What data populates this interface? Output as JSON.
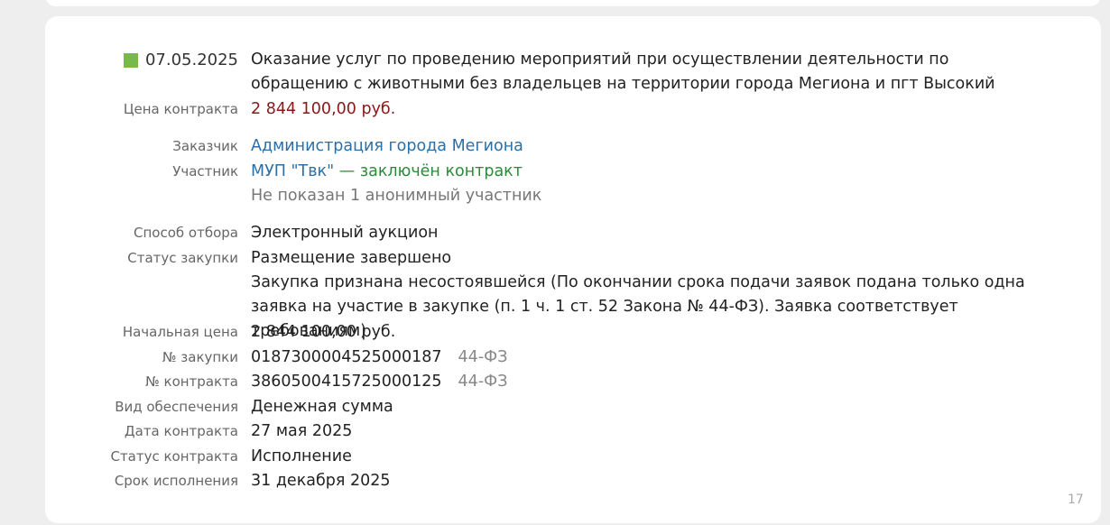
{
  "tender": {
    "date": "07.05.2025",
    "title": "Оказание услуг по проведению мероприятий при осуществлении деятельности по обращению с животными без владельцев на территории города Мегиона и пгт Высокий",
    "price_label": "Цена контракта",
    "price": "2 844 100,00 руб.",
    "customer_label": "Заказчик",
    "customer": "Администрация города Мегиона",
    "participant_label": "Участник",
    "participant": "МУП \"Твк\"",
    "participant_status": "— заключён контракт",
    "hidden_participants": "Не показан 1 анонимный участник",
    "method_label": "Способ отбора",
    "method": "Электронный аукцион",
    "status_label": "Статус закупки",
    "status": "Размещение завершено",
    "status_note": "Закупка признана несостоявшейся (По окончании срока подачи заявок подана только одна заявка на участие в закупке (п. 1 ч. 1 ст. 52 Закона № 44-ФЗ). Заявка соответствует требованиям)",
    "start_price_label": "Начальная цена",
    "start_price": "2 844 100,00 руб.",
    "purchase_no_label": "№ закупки",
    "purchase_no": "0187300004525000187",
    "purchase_law": "44-ФЗ",
    "contract_no_label": "№ контракта",
    "contract_no": "3860500415725000125",
    "contract_law": "44-ФЗ",
    "security_label": "Вид обеспечения",
    "security": "Денежная сумма",
    "contract_date_label": "Дата контракта",
    "contract_date": "27 мая 2025",
    "contract_status_label": "Статус контракта",
    "contract_status": "Исполнение",
    "deadline_label": "Срок исполнения",
    "deadline": "31 декабря 2025"
  },
  "page_number": "17",
  "colors": {
    "status_square": "#78b94b",
    "price": "#8a1818",
    "link": "#2b6fa8",
    "contract_status": "#2b8a3a"
  },
  "icons": {
    "hint": "lightbulb-icon"
  }
}
